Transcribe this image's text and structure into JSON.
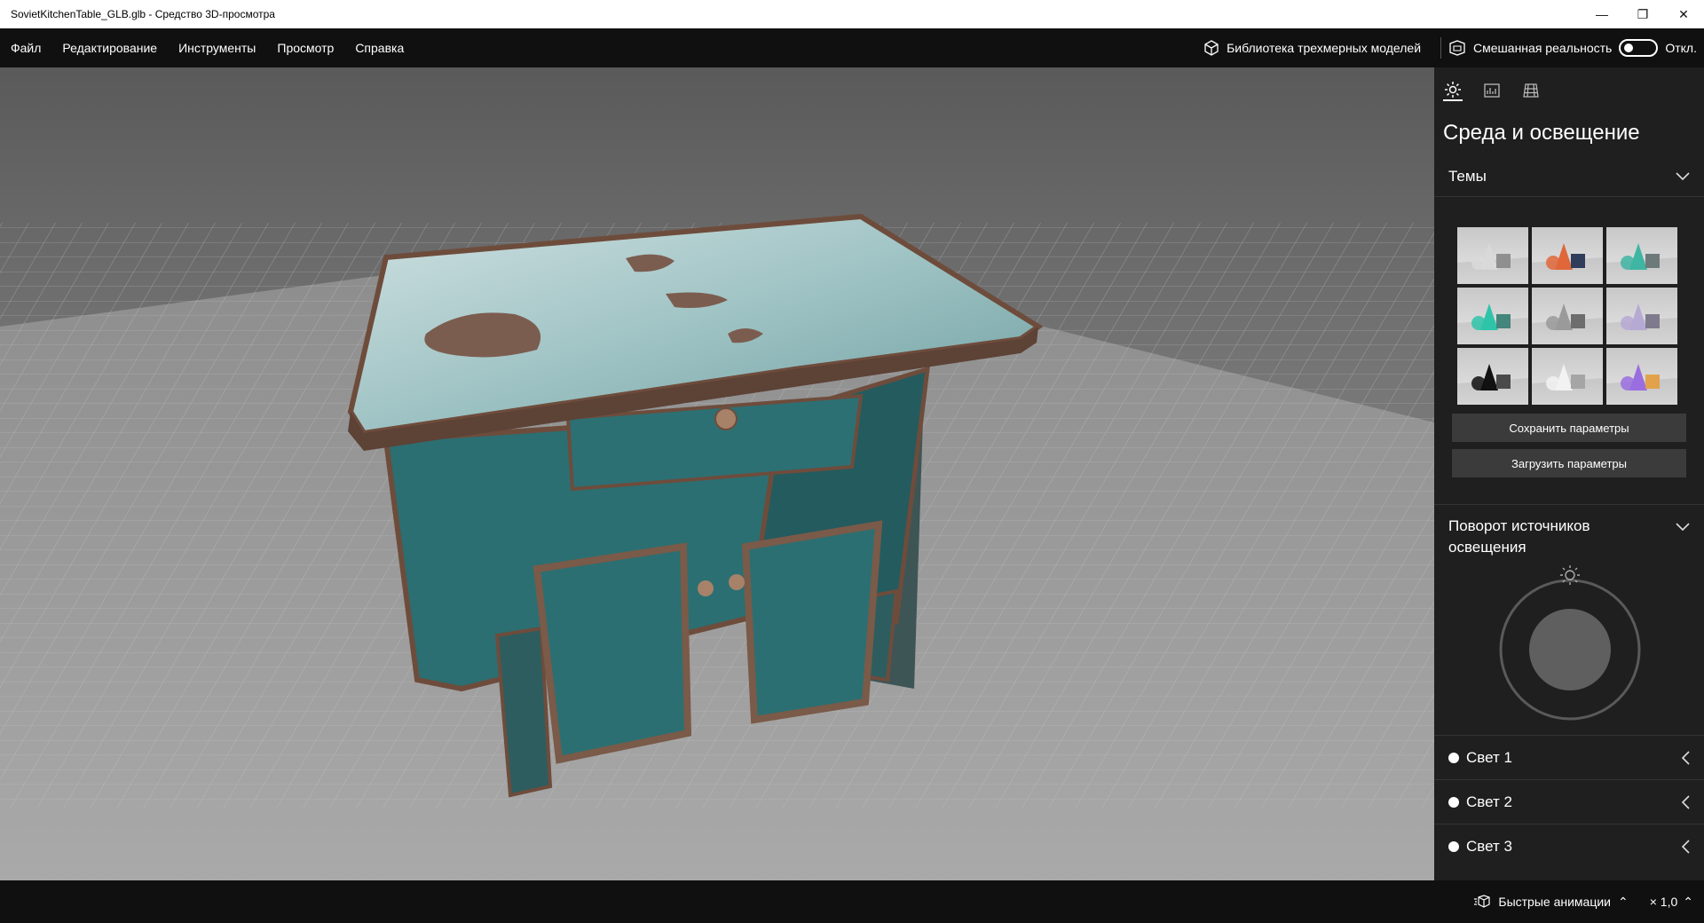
{
  "window": {
    "title": "SovietKitchenTable_GLB.glb - Средство 3D-просмотра",
    "minimize_icon": "—",
    "restore_icon": "❐",
    "close_icon": "✕"
  },
  "menu": {
    "items": [
      "Файл",
      "Редактирование",
      "Инструменты",
      "Просмотр",
      "Справка"
    ],
    "library_label": "Библиотека трехмерных моделей",
    "mixed_reality_label": "Смешанная реальность",
    "mixed_reality_state": "Откл."
  },
  "side_panel": {
    "tabs": [
      "sun-icon",
      "stats-icon",
      "grid-icon"
    ],
    "title": "Среда и освещение",
    "themes_header": "Темы",
    "save_button": "Сохранить параметры",
    "load_button": "Загрузить параметры",
    "rotation_header": "Поворот источников освещения",
    "lights": [
      "Свет 1",
      "Свет 2",
      "Свет 3"
    ],
    "theme_colors": [
      [
        "#d9d9d9",
        "#8f8f8f"
      ],
      [
        "#e0673a",
        "#2f3c5a"
      ],
      [
        "#3fb5a3",
        "#6e7a7a"
      ],
      [
        "#2ec4a9",
        "#44857c"
      ],
      [
        "#9a9a9a",
        "#6d6d6d"
      ],
      [
        "#b6a9d4",
        "#7f7a8c"
      ],
      [
        "#111111",
        "#4a4a4a"
      ],
      [
        "#f2f2f2",
        "#a5a5a5"
      ],
      [
        "#9a6ee0",
        "#e2a24c"
      ]
    ]
  },
  "bottom": {
    "animation_label": "Быстрые анимации",
    "speed": "× 1,0",
    "chevron": "⌃"
  },
  "colors": {
    "panel_bg": "#1f1f1f",
    "bar_bg": "#101010",
    "cabinet_teal": "#2b6f72",
    "cabinet_wood": "#6e4c3c"
  }
}
